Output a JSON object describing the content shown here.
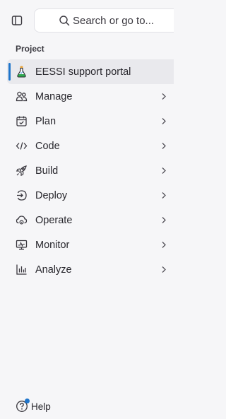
{
  "search": {
    "label": "Search or go to...",
    "icon": "search-icon"
  },
  "sidebar": {
    "toggle_icon": "sidebar-toggle-icon",
    "section_label": "Project",
    "items": [
      {
        "label": "EESSI support portal",
        "icon": "project-avatar-icon",
        "active": true,
        "chevron": false
      },
      {
        "label": "Manage",
        "icon": "users-icon",
        "active": false,
        "chevron": true
      },
      {
        "label": "Plan",
        "icon": "calendar-check-icon",
        "active": false,
        "chevron": true
      },
      {
        "label": "Code",
        "icon": "code-icon",
        "active": false,
        "chevron": true
      },
      {
        "label": "Build",
        "icon": "rocket-icon",
        "active": false,
        "chevron": true
      },
      {
        "label": "Deploy",
        "icon": "deploy-icon",
        "active": false,
        "chevron": true
      },
      {
        "label": "Operate",
        "icon": "cloud-gear-icon",
        "active": false,
        "chevron": true
      },
      {
        "label": "Monitor",
        "icon": "monitor-icon",
        "active": false,
        "chevron": true
      },
      {
        "label": "Analyze",
        "icon": "chart-icon",
        "active": false,
        "chevron": true
      }
    ]
  },
  "help": {
    "label": "Help",
    "icon": "help-icon"
  },
  "colors": {
    "accent": "#1f75cb",
    "background": "#f6f6f8",
    "active_bg": "#e9e9ed",
    "text": "#28272d"
  }
}
